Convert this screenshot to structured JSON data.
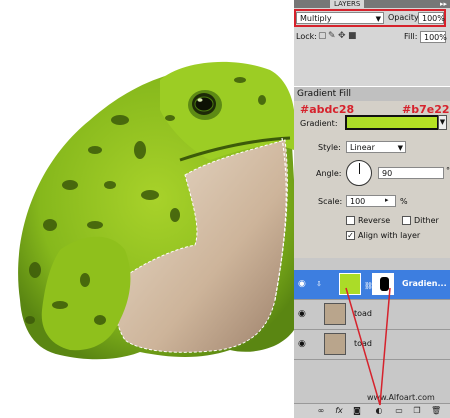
{
  "panel": {
    "tab_label": "LAYERS",
    "tab_arrow": "▸▸",
    "blend_mode": "Multiply",
    "opacity_label": "Opacity:",
    "opacity_value": "100%",
    "lock_label": "Lock:",
    "fill_label": "Fill:",
    "fill_value": "100%"
  },
  "dialog": {
    "title": "Gradient Fill",
    "gradient_label": "Gradient:",
    "gradient_color_left": "#abdc28",
    "gradient_color_right": "#b7e223",
    "hex_left": "#abdc28",
    "hex_right": "#b7e223",
    "style_label": "Style:",
    "style_value": "Linear",
    "angle_label": "Angle:",
    "angle_value": "90",
    "angle_unit": "°",
    "scale_label": "Scale:",
    "scale_value": "100",
    "scale_unit": "%",
    "reverse_label": "Reverse",
    "dither_label": "Dither",
    "align_label": "Align with layer",
    "align_checked": true,
    "reverse_checked": false,
    "dither_checked": false
  },
  "layers": [
    {
      "name": "Gradien...",
      "selected": true
    },
    {
      "name": "toad",
      "selected": false
    },
    {
      "name": "toad",
      "selected": false
    }
  ],
  "watermark": "www.Alfoart.com",
  "colors": {
    "frog_green": "#8fc01c",
    "frog_dark": "#3c5a0a",
    "selection_blue": "#3d7ee0",
    "annotation_red": "#d6222c"
  },
  "bottom_icons": [
    "link-icon",
    "fx-icon",
    "mask-icon",
    "adjustment-icon",
    "folder-icon",
    "new-layer-icon",
    "trash-icon"
  ]
}
